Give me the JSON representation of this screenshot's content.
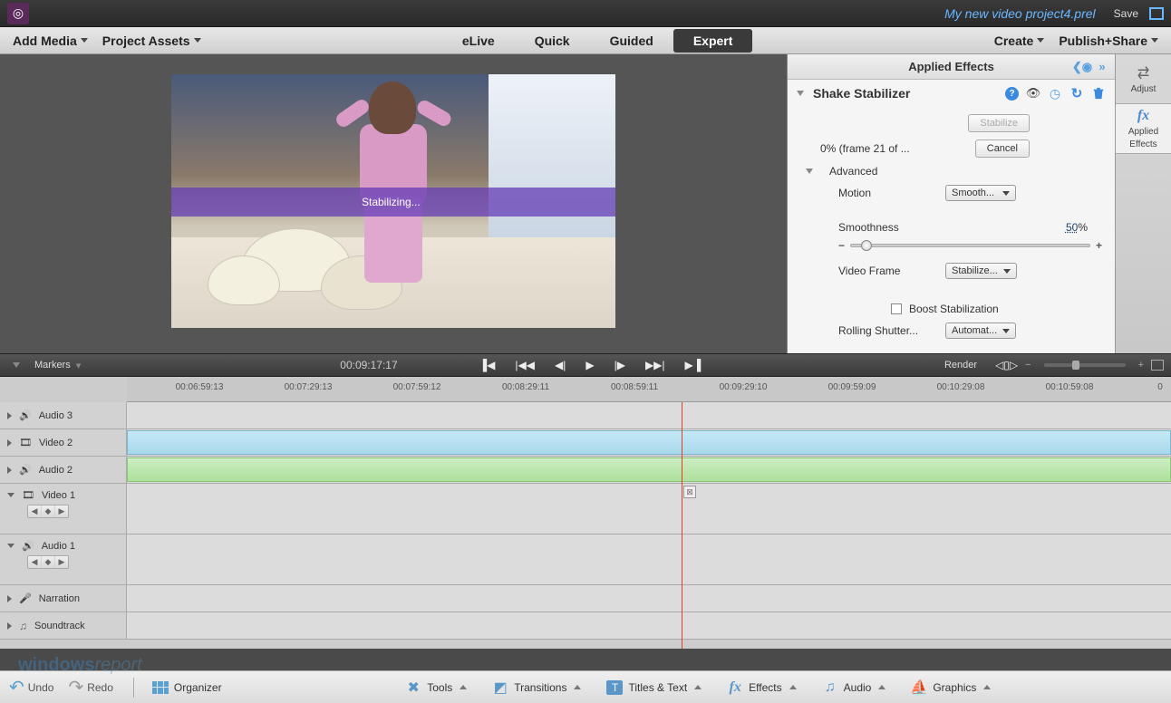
{
  "titlebar": {
    "project_name": "My new video project4.prel",
    "save_label": "Save"
  },
  "top_menu": {
    "add_media": "Add Media",
    "project_assets": "Project Assets",
    "create": "Create",
    "publish_share": "Publish+Share"
  },
  "modes": {
    "elive": "eLive",
    "quick": "Quick",
    "guided": "Guided",
    "expert": "Expert",
    "active": "expert"
  },
  "preview": {
    "progress_text": "Stabilizing..."
  },
  "effects_panel": {
    "header": "Applied Effects",
    "effect_name": "Shake Stabilizer",
    "stabilize_btn": "Stabilize",
    "cancel_btn": "Cancel",
    "progress_text": "0% (frame 21 of ...",
    "advanced_label": "Advanced",
    "motion_label": "Motion",
    "motion_value": "Smooth...",
    "smoothness_label": "Smoothness",
    "smoothness_value": "50",
    "smoothness_unit": "%",
    "video_frame_label": "Video Frame",
    "video_frame_value": "Stabilize...",
    "boost_label": "Boost Stabilization",
    "rolling_shutter_label": "Rolling Shutter...",
    "rolling_shutter_value": "Automat..."
  },
  "right_tabs": {
    "adjust": "Adjust",
    "applied_effects_l1": "Applied",
    "applied_effects_l2": "Effects"
  },
  "transport": {
    "markers_label": "Markers",
    "timecode": "00:09:17:17",
    "render_label": "Render"
  },
  "ruler": {
    "times": [
      "00:06:59:13",
      "00:07:29:13",
      "00:07:59:12",
      "00:08:29:11",
      "00:08:59:11",
      "00:09:29:10",
      "00:09:59:09",
      "00:10:29:08",
      "00:10:59:08"
    ],
    "end_label": "0"
  },
  "tracks": {
    "audio3": "Audio 3",
    "video2": "Video 2",
    "audio2": "Audio 2",
    "video1": "Video 1",
    "audio1": "Audio 1",
    "narration": "Narration",
    "soundtrack": "Soundtrack"
  },
  "bottom": {
    "undo": "Undo",
    "redo": "Redo",
    "organizer": "Organizer",
    "tools": "Tools",
    "transitions": "Transitions",
    "titles_text": "Titles & Text",
    "effects": "Effects",
    "audio": "Audio",
    "graphics": "Graphics"
  },
  "watermark": {
    "w1": "windows",
    "w2": "report"
  }
}
